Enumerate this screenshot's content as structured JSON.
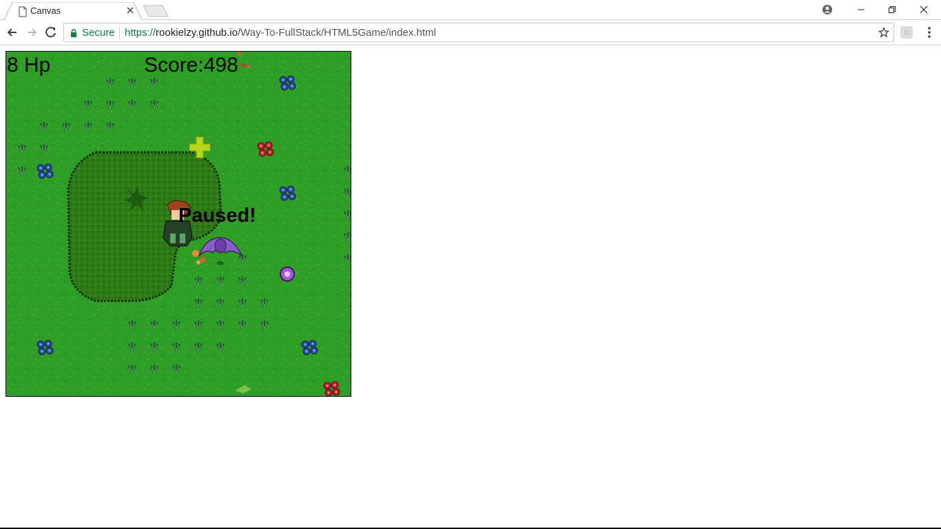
{
  "browser": {
    "tab_title": "Canvas",
    "secure_label": "Secure",
    "url_scheme": "https://",
    "url_host": "rookielzy.github.io",
    "url_path": "/Way-To-FullStack/HTML5Game/index.html"
  },
  "game": {
    "hp_text": "8 Hp",
    "score_text": "Score:498",
    "status_text": "Paused!",
    "colors": {
      "grass": "#2f9e27",
      "bush": "#2d7a17",
      "bush_outline": "#1a3d0c",
      "heal_cross": "#b8d61c",
      "orb": "#a45ad6"
    }
  }
}
